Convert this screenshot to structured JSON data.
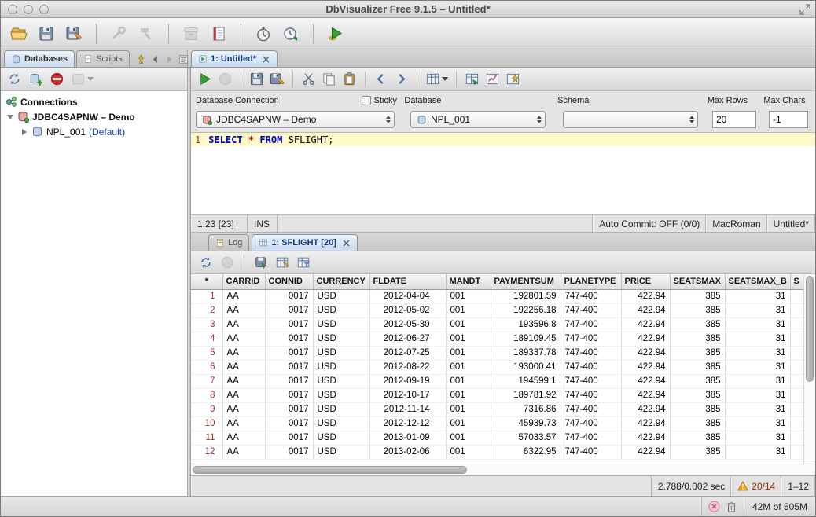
{
  "window": {
    "title": "DbVisualizer Free 9.1.5 – Untitled*"
  },
  "nav_tabs": {
    "databases": "Databases",
    "scripts": "Scripts"
  },
  "editor_tab": {
    "label": "1: Untitled*"
  },
  "sidebar": {
    "root_label": "Connections",
    "connection_label": "JDBC4SAPNW – Demo",
    "database_label": "NPL_001",
    "database_suffix": "(Default)"
  },
  "commander": {
    "connection_label": "Database Connection",
    "sticky_label": "Sticky",
    "database_label": "Database",
    "schema_label": "Schema",
    "max_rows_label": "Max Rows",
    "max_chars_label": "Max Chars",
    "connection_value": "JDBC4SAPNW – Demo",
    "database_value": "NPL_001",
    "schema_value": "",
    "max_rows_value": "20",
    "max_chars_value": "-1"
  },
  "editor": {
    "line_number": "1",
    "sql_select": "SELECT",
    "sql_star": "*",
    "sql_from": "FROM",
    "sql_rest": "SFLIGHT;",
    "status_caret": "1:23 [23]",
    "status_mode": "INS",
    "status_autocommit": "Auto Commit: OFF (0/0)",
    "status_encoding": "MacRoman",
    "status_document": "Untitled*"
  },
  "results": {
    "log_tab": "Log",
    "grid_tab": "1: SFLIGHT [20]",
    "status_time": "2.788/0.002 sec",
    "status_warning": "20/14",
    "status_range": "1–12"
  },
  "grid": {
    "columns": [
      "*",
      "CARRID",
      "CONNID",
      "CURRENCY",
      "FLDATE",
      "MANDT",
      "PAYMENTSUM",
      "PLANETYPE",
      "PRICE",
      "SEATSMAX",
      "SEATSMAX_B",
      "S"
    ],
    "rows": [
      [
        "1",
        "AA",
        "0017",
        "USD",
        "2012-04-04",
        "001",
        "192801.59",
        "747-400",
        "422.94",
        "385",
        "31",
        ""
      ],
      [
        "2",
        "AA",
        "0017",
        "USD",
        "2012-05-02",
        "001",
        "192256.18",
        "747-400",
        "422.94",
        "385",
        "31",
        ""
      ],
      [
        "3",
        "AA",
        "0017",
        "USD",
        "2012-05-30",
        "001",
        "193596.8",
        "747-400",
        "422.94",
        "385",
        "31",
        ""
      ],
      [
        "4",
        "AA",
        "0017",
        "USD",
        "2012-06-27",
        "001",
        "189109.45",
        "747-400",
        "422.94",
        "385",
        "31",
        ""
      ],
      [
        "5",
        "AA",
        "0017",
        "USD",
        "2012-07-25",
        "001",
        "189337.78",
        "747-400",
        "422.94",
        "385",
        "31",
        ""
      ],
      [
        "6",
        "AA",
        "0017",
        "USD",
        "2012-08-22",
        "001",
        "193000.41",
        "747-400",
        "422.94",
        "385",
        "31",
        ""
      ],
      [
        "7",
        "AA",
        "0017",
        "USD",
        "2012-09-19",
        "001",
        "194599.1",
        "747-400",
        "422.94",
        "385",
        "31",
        ""
      ],
      [
        "8",
        "AA",
        "0017",
        "USD",
        "2012-10-17",
        "001",
        "189781.92",
        "747-400",
        "422.94",
        "385",
        "31",
        ""
      ],
      [
        "9",
        "AA",
        "0017",
        "USD",
        "2012-11-14",
        "001",
        "7316.86",
        "747-400",
        "422.94",
        "385",
        "31",
        ""
      ],
      [
        "10",
        "AA",
        "0017",
        "USD",
        "2012-12-12",
        "001",
        "45939.73",
        "747-400",
        "422.94",
        "385",
        "31",
        ""
      ],
      [
        "11",
        "AA",
        "0017",
        "USD",
        "2013-01-09",
        "001",
        "57033.57",
        "747-400",
        "422.94",
        "385",
        "31",
        ""
      ],
      [
        "12",
        "AA",
        "0017",
        "USD",
        "2013-02-06",
        "001",
        "6322.95",
        "747-400",
        "422.94",
        "385",
        "31",
        ""
      ]
    ]
  },
  "statusbar": {
    "memory": "42M of 505M"
  },
  "icons": {
    "main_toolbar": [
      "open-folder-icon",
      "save-icon",
      "save-as-icon",
      "driver-manager-icon",
      "tool-properties-icon",
      "archive-icon",
      "notes-icon",
      "stopwatch-icon",
      "monitor-icon",
      "sql-commander-icon"
    ],
    "colors": {
      "keyword_blue": "#0000cc",
      "row_number_red": "#a03333",
      "warning_orange": "#f2a71b",
      "default_blue": "#1a44bb"
    }
  }
}
